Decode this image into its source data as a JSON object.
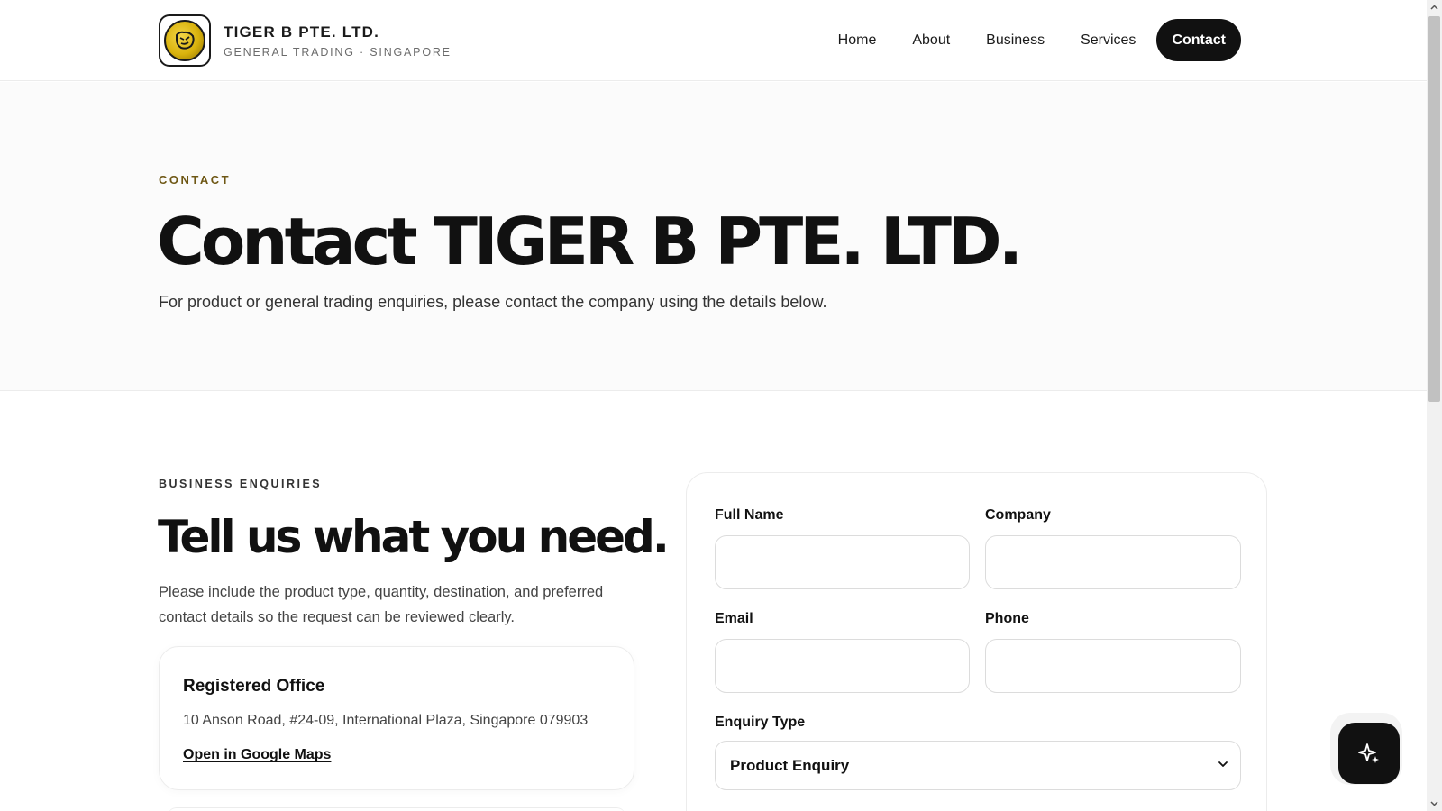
{
  "brand": {
    "name": "TIGER B PTE. LTD.",
    "tagline": "GENERAL TRADING · SINGAPORE",
    "logo_icon": "tiger-head-icon"
  },
  "nav": {
    "items": [
      {
        "label": "Home"
      },
      {
        "label": "About"
      },
      {
        "label": "Business"
      },
      {
        "label": "Services"
      },
      {
        "label": "Contact",
        "active": true
      }
    ]
  },
  "hero": {
    "eyebrow": "CONTACT",
    "title": "Contact TIGER B PTE. LTD.",
    "description": "For product or general trading enquiries, please contact the company using the details below."
  },
  "enquiries": {
    "eyebrow": "BUSINESS ENQUIRIES",
    "title": "Tell us what you need.",
    "description": "Please include the product type, quantity, destination, and preferred contact details so the request can be reviewed clearly.",
    "office": {
      "title": "Registered Office",
      "address": "10 Anson Road, #24-09, International Plaza, Singapore 079903",
      "link": "Open in Google Maps"
    }
  },
  "form": {
    "full_name_label": "Full Name",
    "full_name_value": "",
    "company_label": "Company",
    "company_value": "",
    "email_label": "Email",
    "email_value": "",
    "phone_label": "Phone",
    "phone_value": "",
    "enquiry_type_label": "Enquiry Type",
    "enquiry_type_value": "Product Enquiry"
  },
  "colors": {
    "accent_dark": "#111111",
    "eyebrow_gold": "#6e5714",
    "logo_gold": "#d9b20c"
  },
  "fab": {
    "icon": "sparkle-icon"
  }
}
